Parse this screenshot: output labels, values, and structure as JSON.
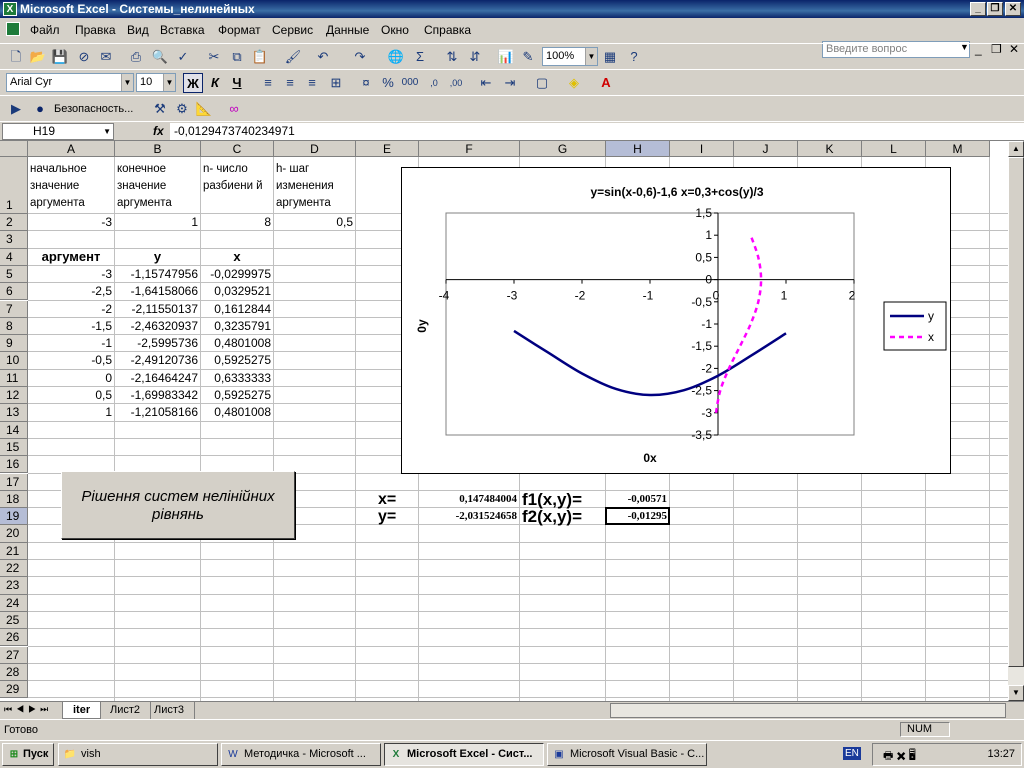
{
  "window": {
    "title": "Microsoft Excel - Системы_нелинейных",
    "app_icon": "X"
  },
  "menu": [
    "Файл",
    "Правка",
    "Вид",
    "Вставка",
    "Формат",
    "Сервис",
    "Данные",
    "Окно",
    "Справка"
  ],
  "ask_placeholder": "Введите вопрос",
  "toolbar": {
    "zoom": "100%",
    "font": "Arial Cyr",
    "size": "10",
    "bold": "Ж",
    "italic": "К",
    "underline": "Ч",
    "security": "Безопасность..."
  },
  "formula": {
    "cell": "H19",
    "fx": "fx",
    "content": "-0,0129473740234971"
  },
  "columns": [
    "A",
    "B",
    "C",
    "D",
    "E",
    "F",
    "G",
    "H",
    "I",
    "J",
    "K",
    "L",
    "M"
  ],
  "rows": [
    "1",
    "2",
    "3",
    "4",
    "5",
    "6",
    "7",
    "8",
    "9",
    "10",
    "11",
    "12",
    "13",
    "14",
    "15",
    "16",
    "17",
    "18",
    "19",
    "20",
    "21",
    "22",
    "23",
    "24",
    "25",
    "26",
    "27",
    "28",
    "29"
  ],
  "headers": {
    "a1": "начальное значение аргумента",
    "b1": "конечное значение аргумента",
    "c1": "n- число разбиени й",
    "d1": "h- шаг изменения аргумента"
  },
  "params": {
    "a2": "-3",
    "b2": "1",
    "c2": "8",
    "d2": "0,5"
  },
  "table_header": {
    "arg": "аргумент",
    "y": "y",
    "x": "x"
  },
  "table": [
    [
      "-3",
      "-1,15747956",
      "-0,0299975"
    ],
    [
      "-2,5",
      "-1,64158066",
      "0,0329521"
    ],
    [
      "-2",
      "-2,11550137",
      "0,1612844"
    ],
    [
      "-1,5",
      "-2,46320937",
      "0,3235791"
    ],
    [
      "-1",
      "-2,5995736",
      "0,4801008"
    ],
    [
      "-0,5",
      "-2,49120736",
      "0,5925275"
    ],
    [
      "0",
      "-2,16464247",
      "0,6333333"
    ],
    [
      "0,5",
      "-1,69983342",
      "0,5925275"
    ],
    [
      "1",
      "-1,21058166",
      "0,4801008"
    ]
  ],
  "results": {
    "x_label": "x=",
    "x_val": "0,147484004",
    "f1_label": "f1(x,y)=",
    "f1_val": "-0,00571",
    "y_label": "y=",
    "y_val": "-2,031524658",
    "f2_label": "f2(x,y)=",
    "f2_val": "-0,01295"
  },
  "button_text": "Рішення систем нелінійних рівнянь",
  "chart_data": {
    "type": "line",
    "title": "y=sin(x-0,6)-1,6        x=0,3+cos(y)/3",
    "xlabel": "0x",
    "ylabel": "0y",
    "xlim": [
      -4,
      2
    ],
    "ylim": [
      -3.5,
      1.5
    ],
    "xticks": [
      "-4",
      "-3",
      "-2",
      "-1",
      "0",
      "1",
      "2"
    ],
    "yticks": [
      "1,5",
      "1",
      "0,5",
      "0",
      "-0,5",
      "-1",
      "-1,5",
      "-2",
      "-2,5",
      "-3",
      "-3,5"
    ],
    "legend_position": "right",
    "series": [
      {
        "name": "y",
        "color": "#000080",
        "style": "solid",
        "x": [
          -3,
          -2.5,
          -2,
          -1.5,
          -1,
          -0.5,
          0,
          0.5,
          1
        ],
        "y": [
          -1.15747956,
          -1.64158066,
          -2.11550137,
          -2.46320937,
          -2.5995736,
          -2.49120736,
          -2.16464247,
          -1.69983342,
          -1.21058166
        ]
      },
      {
        "name": "x",
        "color": "#ff00ff",
        "style": "dashed",
        "x": [
          -0.0299975,
          0.0329521,
          0.1612844,
          0.3235791,
          0.4801008,
          0.5925275,
          0.6333333,
          0.5925275,
          0.4801008
        ],
        "y": [
          -3,
          -2.5,
          -2,
          -1.5,
          -1,
          -0.5,
          0,
          0.5,
          1
        ]
      }
    ]
  },
  "sheets": [
    "iter",
    "Лист2",
    "Лист3"
  ],
  "status": {
    "left": "Готово",
    "num": "NUM"
  },
  "taskbar": {
    "start": "Пуск",
    "tasks": [
      "vish",
      "Методичка - Microsoft ...",
      "Microsoft Excel - Сист...",
      "Microsoft Visual Basic - C..."
    ],
    "lang": "EN",
    "time": "13:27"
  }
}
